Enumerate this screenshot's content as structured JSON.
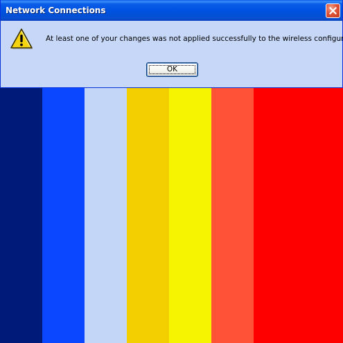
{
  "dialog": {
    "title": "Network Connections",
    "icon": "warning-icon",
    "message": "At least one of your changes was not applied successfully to the wireless configuration.",
    "ok_label": "OK",
    "close_icon": "close-icon"
  },
  "colors": {
    "title_bar": "#0054e3",
    "dialog_body": "#c7d7f8",
    "close_button": "#e0543a",
    "warning_yellow": "#f5d40f"
  },
  "background_bars": [
    {
      "color": "#001a7a"
    },
    {
      "color": "#0a47ff"
    },
    {
      "color": "#c4d6f8"
    },
    {
      "color": "#f3ce00"
    },
    {
      "color": "#f7f400"
    },
    {
      "color": "#ff5236"
    },
    {
      "color": "#ff0000"
    }
  ]
}
